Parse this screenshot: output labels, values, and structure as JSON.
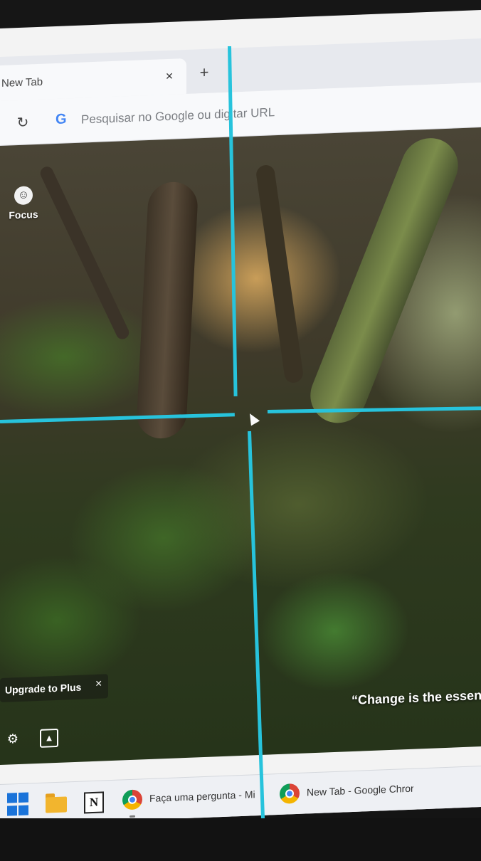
{
  "browser": {
    "tab": {
      "title": "New Tab",
      "close_glyph": "×"
    },
    "new_tab_glyph": "+",
    "reload_glyph": "↻",
    "omnibox": {
      "google_glyph": "G",
      "placeholder": "Pesquisar no Google ou digitar URL"
    }
  },
  "ntp": {
    "focus": {
      "label": "Focus",
      "icon": "brain-icon",
      "icon_glyph": "☺"
    },
    "upgrade": {
      "label": "Upgrade to Plus",
      "close_glyph": "×"
    },
    "settings_icon_glyph": "⚙",
    "photo_icon_glyph": "▲",
    "quote": "“Change is the essen"
  },
  "taskbar": {
    "notion_glyph": "N",
    "apps": [
      {
        "label": "Faça uma pergunta - Mi"
      },
      {
        "label": "New Tab - Google Chror"
      }
    ]
  },
  "colors": {
    "snap_guide": "#27c3dc",
    "windows_blue": "#1a73d9"
  }
}
